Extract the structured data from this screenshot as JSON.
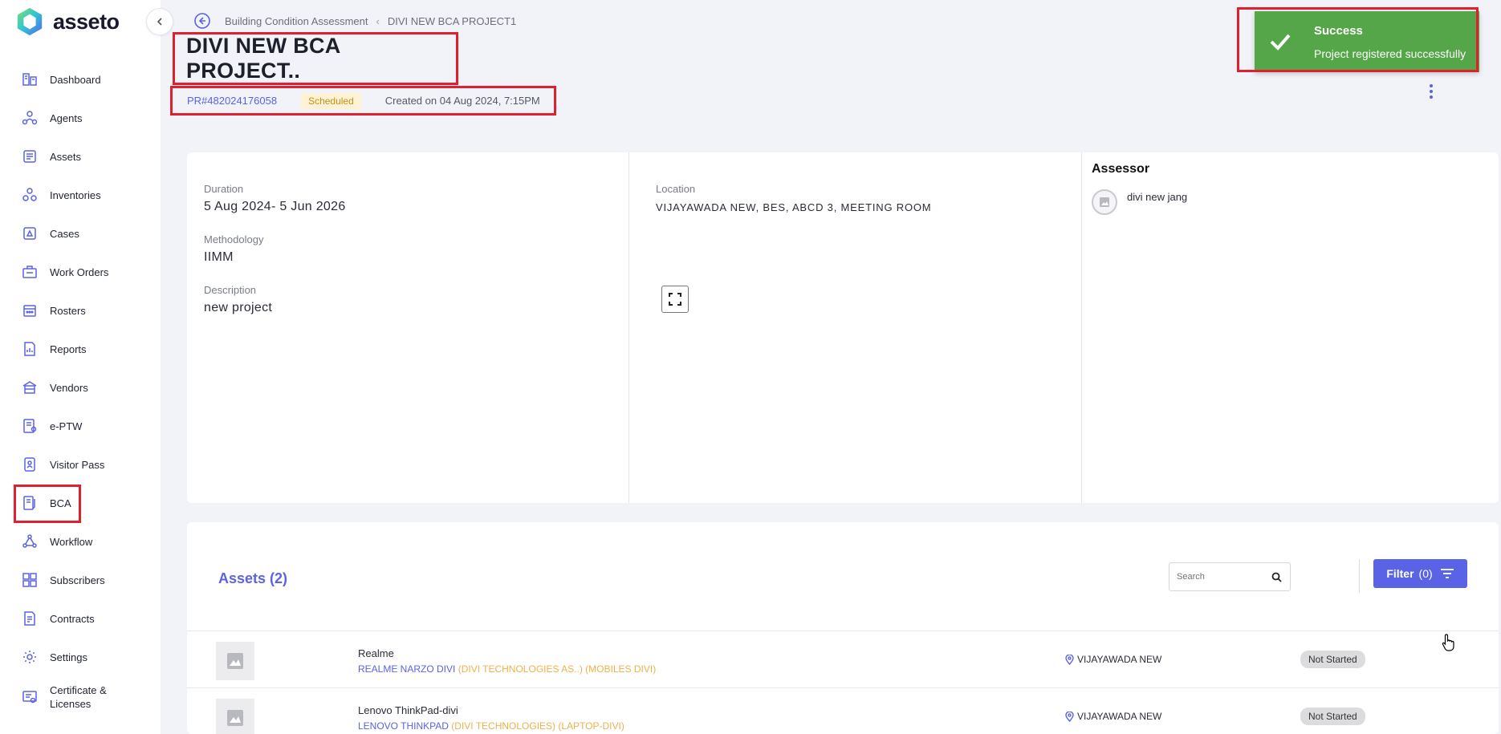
{
  "brand": {
    "name": "asseto"
  },
  "sidebar": {
    "items": [
      {
        "label": "Dashboard",
        "icon": "dashboard-icon"
      },
      {
        "label": "Agents",
        "icon": "agents-icon"
      },
      {
        "label": "Assets",
        "icon": "assets-icon"
      },
      {
        "label": "Inventories",
        "icon": "inventories-icon"
      },
      {
        "label": "Cases",
        "icon": "cases-icon"
      },
      {
        "label": "Work Orders",
        "icon": "work-orders-icon"
      },
      {
        "label": "Rosters",
        "icon": "rosters-icon"
      },
      {
        "label": "Reports",
        "icon": "reports-icon"
      },
      {
        "label": "Vendors",
        "icon": "vendors-icon"
      },
      {
        "label": "e-PTW",
        "icon": "eptw-icon"
      },
      {
        "label": "Visitor Pass",
        "icon": "visitor-pass-icon"
      },
      {
        "label": "BCA",
        "icon": "bca-icon"
      },
      {
        "label": "Workflow",
        "icon": "workflow-icon"
      },
      {
        "label": "Subscribers",
        "icon": "subscribers-icon"
      },
      {
        "label": "Contracts",
        "icon": "contracts-icon"
      },
      {
        "label": "Settings",
        "icon": "settings-icon"
      },
      {
        "label": "Certificate & Licenses",
        "icon": "certificate-icon"
      }
    ]
  },
  "breadcrumb": {
    "parent": "Building Condition Assessment",
    "current": "DIVI NEW BCA PROJECT1"
  },
  "project": {
    "title": "DIVI NEW BCA PROJECT..",
    "id": "PR#482024176058",
    "status": "Scheduled",
    "created": "Created on 04 Aug 2024, 7:15PM"
  },
  "toast": {
    "title": "Success",
    "message": "Project registered successfully"
  },
  "details": {
    "duration_label": "Duration",
    "duration": "5 Aug 2024- 5 Jun 2026",
    "methodology_label": "Methodology",
    "methodology": "IIMM",
    "description_label": "Description",
    "description": "new project",
    "location_label": "Location",
    "location": "VIJAYAWADA NEW, BES, ABCD 3, MEETING ROOM",
    "assessor_label": "Assessor",
    "assessor_name": "divi new jang"
  },
  "assets": {
    "title": "Assets (2)",
    "search_placeholder": "Search",
    "filter_label": "Filter",
    "filter_count": "(0)",
    "rows": [
      {
        "name": "Realme",
        "product": "REALME NARZO DIVI",
        "meta": " (DIVI TECHNOLOGIES AS..) (MOBILES DIVI)",
        "location": "VIJAYAWADA NEW",
        "status": "Not Started"
      },
      {
        "name": "Lenovo ThinkPad-divi",
        "product": "LENOVO THINKPAD",
        "meta": " (DIVI TECHNOLOGIES) (LAPTOP-DIVI)",
        "location": "VIJAYAWADA NEW",
        "status": "Not Started"
      }
    ]
  },
  "colors": {
    "accent": "#5a63e6",
    "success": "#55a649",
    "highlight": "#e0202e",
    "badge_bg": "#fff3d6",
    "badge_text": "#c98d1a"
  }
}
